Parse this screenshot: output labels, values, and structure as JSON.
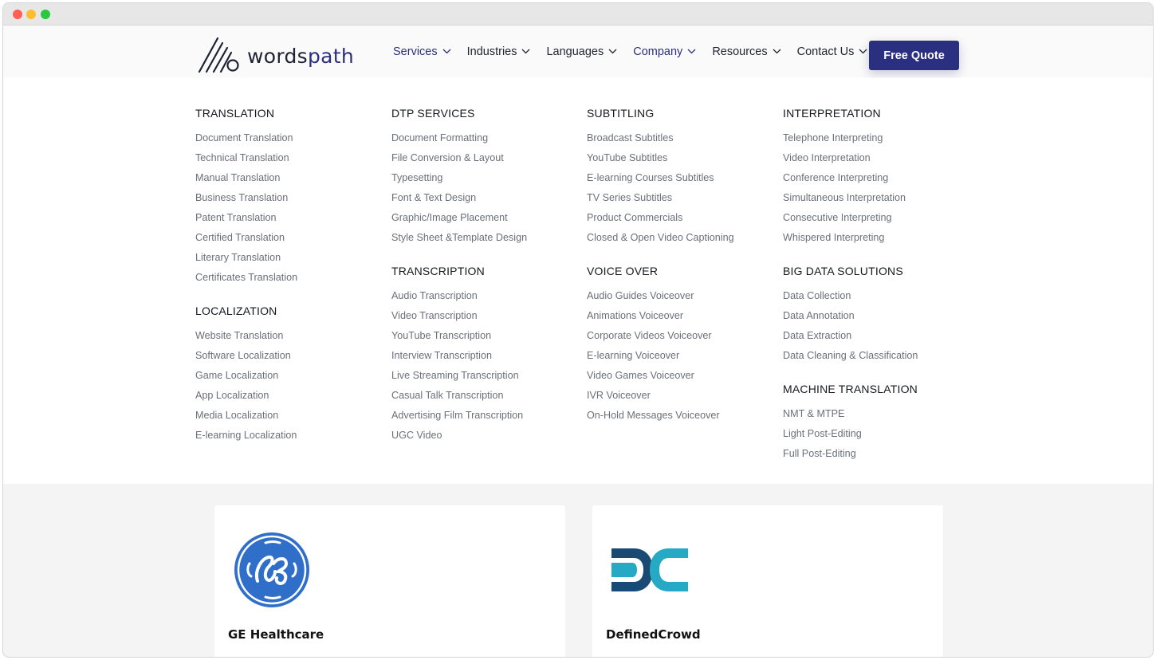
{
  "brand": {
    "part1": "words",
    "part2": "path"
  },
  "nav": [
    {
      "label": "Services",
      "active": true
    },
    {
      "label": "Industries",
      "active": false
    },
    {
      "label": "Languages",
      "active": false
    },
    {
      "label": "Company",
      "active": true
    },
    {
      "label": "Resources",
      "active": false
    },
    {
      "label": "Contact Us",
      "active": false
    }
  ],
  "cta": {
    "label": "Free Quote"
  },
  "colors": {
    "accent": "#2b2f7f",
    "ge_blue": "#2f6fca",
    "dc_dark": "#1a4a73",
    "dc_light": "#25a9c4"
  },
  "menu": {
    "col1": [
      {
        "title": "TRANSLATION",
        "items": [
          "Document Translation",
          "Technical Translation",
          "Manual Translation",
          "Business Translation",
          "Patent Translation",
          "Certified Translation",
          "Literary Translation",
          "Certificates Translation"
        ]
      },
      {
        "title": "LOCALIZATION",
        "items": [
          "Website Translation",
          "Software Localization",
          "Game Localization",
          "App Localization",
          "Media Localization",
          "E-learning Localization"
        ]
      }
    ],
    "col2": [
      {
        "title": "DTP SERVICES",
        "items": [
          "Document Formatting",
          "File Conversion & Layout",
          "Typesetting",
          "Font & Text Design",
          "Graphic/Image Placement",
          "Style Sheet &Template Design"
        ]
      },
      {
        "title": "TRANSCRIPTION",
        "items": [
          "Audio Transcription",
          "Video Transcription",
          "YouTube Transcription",
          "Interview Transcription",
          "Live Streaming Transcription",
          "Casual Talk Transcription",
          "Advertising Film Transcription",
          "UGC Video"
        ]
      }
    ],
    "col3": [
      {
        "title": "SUBTITLING",
        "items": [
          "Broadcast Subtitles",
          "YouTube Subtitles",
          "E-learning Courses Subtitles",
          "TV Series Subtitles",
          "Product Commercials",
          "Closed & Open Video Captioning"
        ]
      },
      {
        "title": "VOICE OVER",
        "items": [
          "Audio Guides Voiceover",
          "Animations Voiceover",
          "Corporate Videos Voiceover",
          "E-learning Voiceover",
          "Video Games Voiceover",
          "IVR Voiceover",
          "On-Hold Messages Voiceover"
        ]
      }
    ],
    "col4": [
      {
        "title": "INTERPRETATION",
        "items": [
          "Telephone Interpreting",
          "Video Interpretation",
          "Conference Interpreting",
          "Simultaneous Interpretation",
          "Consecutive Interpreting",
          "Whispered Interpreting"
        ]
      },
      {
        "title": "BIG DATA SOLUTIONS",
        "items": [
          "Data Collection",
          "Data Annotation",
          "Data Extraction",
          "Data Cleaning & Classification"
        ]
      },
      {
        "title": "MACHINE TRANSLATION",
        "items": [
          "NMT & MTPE",
          "Light Post-Editing",
          "Full Post-Editing"
        ]
      }
    ]
  },
  "clients": [
    {
      "name": "GE Healthcare",
      "logo": "ge-logo"
    },
    {
      "name": "DefinedCrowd",
      "logo": "definedcrowd-logo"
    }
  ]
}
